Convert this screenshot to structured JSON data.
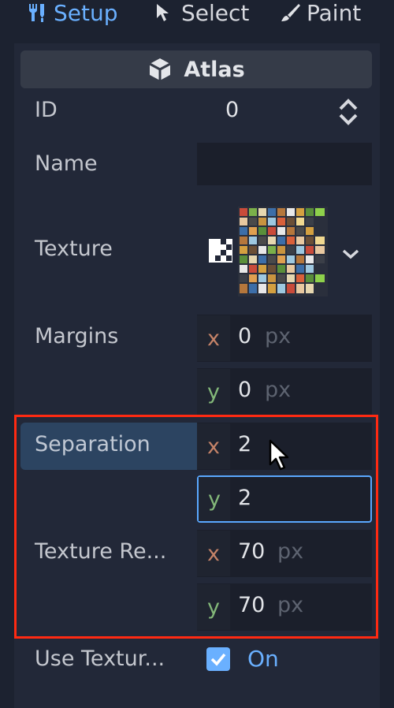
{
  "toolbar": {
    "setup_label": "Setup",
    "select_label": "Select",
    "paint_label": "Paint"
  },
  "header": {
    "title": "Atlas"
  },
  "properties": {
    "id": {
      "label": "ID",
      "value": "0"
    },
    "name": {
      "label": "Name",
      "value": ""
    },
    "texture": {
      "label": "Texture"
    },
    "margins": {
      "label": "Margins",
      "x": "0",
      "y": "0",
      "unit": "px"
    },
    "separation": {
      "label": "Separation",
      "x": "2",
      "y": "2"
    },
    "texture_region": {
      "label": "Texture Re...",
      "x": "70",
      "y": "70",
      "unit": "px"
    },
    "use_texture": {
      "label": "Use Textur...",
      "value": "On",
      "checked": true
    }
  },
  "axis_labels": {
    "x": "x",
    "y": "y"
  },
  "colors": {
    "accent": "#6ab0ff",
    "highlight_border": "#ff2a12",
    "axis_x": "#c58368",
    "axis_y": "#83b879"
  }
}
